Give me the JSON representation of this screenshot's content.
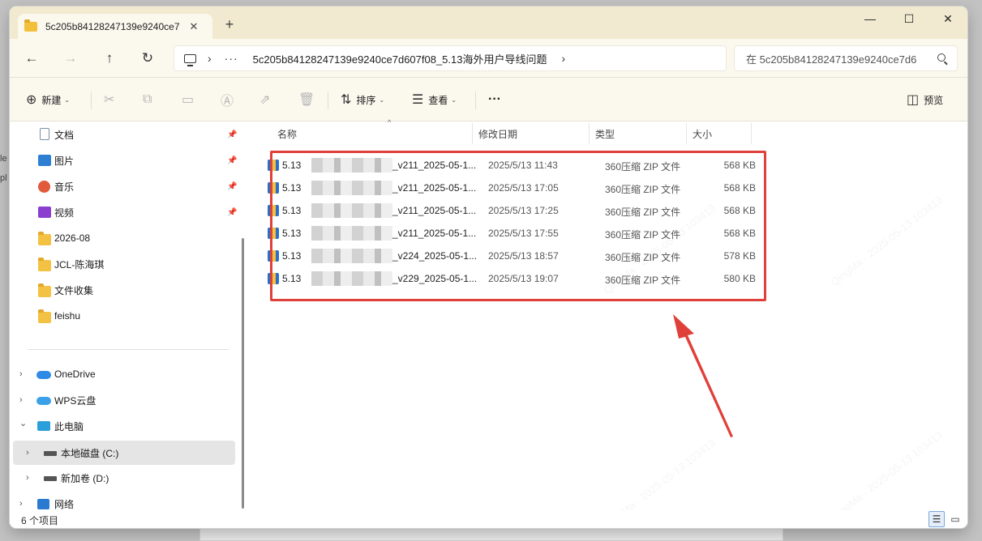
{
  "desktop": {
    "left_text": "le\npl"
  },
  "tab": {
    "title": "5c205b84128247139e9240ce7d",
    "close": "✕",
    "new": "+"
  },
  "window_controls": {
    "minimize": "—",
    "maximize": "☐",
    "close": "✕"
  },
  "nav": {
    "back": "←",
    "forward": "→",
    "up": "↑",
    "refresh": "↻"
  },
  "address": {
    "sep1": "›",
    "more": "···",
    "path": "5c205b84128247139e9240ce7d607f08_5.13海外用户导线问题",
    "sep2": "›"
  },
  "search": {
    "placeholder": "在 5c205b84128247139e9240ce7d6"
  },
  "toolbar": {
    "new_label": "新建",
    "sort_label": "排序",
    "view_label": "查看",
    "more": "···",
    "preview_label": "预览"
  },
  "sidebar": {
    "quick_access": [
      {
        "label": "文档",
        "icon": "document-icon",
        "pinned": true
      },
      {
        "label": "图片",
        "icon": "pictures-icon",
        "pinned": true
      },
      {
        "label": "音乐",
        "icon": "music-icon",
        "pinned": true
      },
      {
        "label": "视频",
        "icon": "video-icon",
        "pinned": true
      },
      {
        "label": "2026-08",
        "icon": "folder-icon",
        "pinned": false
      },
      {
        "label": "JCL-陈海琪",
        "icon": "folder-icon",
        "pinned": false
      },
      {
        "label": "文件收集",
        "icon": "folder-icon",
        "pinned": false
      },
      {
        "label": "feishu",
        "icon": "folder-icon",
        "pinned": false
      }
    ],
    "tree": [
      {
        "label": "OneDrive",
        "icon": "onedrive-icon",
        "expander": "›"
      },
      {
        "label": "WPS云盘",
        "icon": "wps-cloud-icon",
        "expander": "›"
      },
      {
        "label": "此电脑",
        "icon": "this-pc-icon",
        "expander": "⌄"
      },
      {
        "label": "本地磁盘 (C:)",
        "icon": "drive-icon",
        "expander": "›",
        "selected": true
      },
      {
        "label": "新加卷 (D:)",
        "icon": "drive-icon",
        "expander": "›"
      },
      {
        "label": "网络",
        "icon": "network-icon",
        "expander": "›"
      }
    ]
  },
  "columns": {
    "name": "名称",
    "modified": "修改日期",
    "type": "类型",
    "size": "大小",
    "sort_caret": "^"
  },
  "files": [
    {
      "prefix": "5.13",
      "suffix": "_v211_2025-05-1...",
      "date": "2025/5/13 11:43",
      "type": "360压缩 ZIP 文件",
      "size": "568 KB"
    },
    {
      "prefix": "5.13",
      "suffix": "_v211_2025-05-1...",
      "date": "2025/5/13 17:05",
      "type": "360压缩 ZIP 文件",
      "size": "568 KB"
    },
    {
      "prefix": "5.13",
      "suffix": "_v211_2025-05-1...",
      "date": "2025/5/13 17:25",
      "type": "360压缩 ZIP 文件",
      "size": "568 KB"
    },
    {
      "prefix": "5.13",
      "suffix": "_v211_2025-05-1...",
      "date": "2025/5/13 17:55",
      "type": "360压缩 ZIP 文件",
      "size": "568 KB"
    },
    {
      "prefix": "5.13",
      "suffix": "_v224_2025-05-1...",
      "date": "2025/5/13 18:57",
      "type": "360压缩 ZIP 文件",
      "size": "578 KB"
    },
    {
      "prefix": "5.13",
      "suffix": "_v229_2025-05-1...",
      "date": "2025/5/13 19:07",
      "type": "360压缩 ZIP 文件",
      "size": "580 KB"
    }
  ],
  "status": {
    "count": "6 个项目"
  },
  "colors": {
    "highlight": "#e0403a",
    "titlebar": "#f1ead0",
    "accent": "#2c6fc4"
  }
}
